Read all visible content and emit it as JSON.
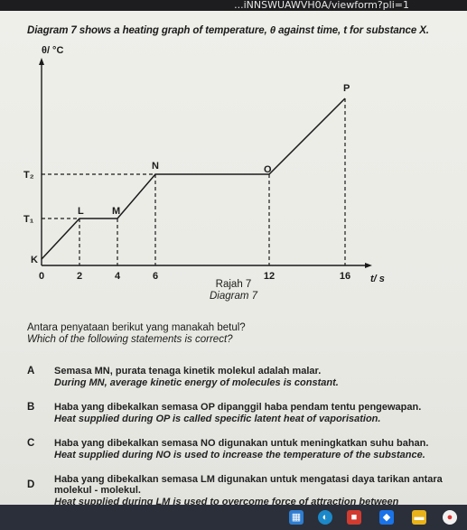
{
  "browser": {
    "url_fragment": "...iNNSWUAWVH0A/viewform?pli=1"
  },
  "intro": "Diagram 7 shows a heating graph of temperature, θ against time, t for substance X.",
  "chart_data": {
    "type": "line",
    "title": "",
    "ylabel": "θ/ °C",
    "xlabel": "t/ s",
    "x_ticks": [
      "0",
      "2",
      "4",
      "6",
      "12",
      "16"
    ],
    "y_ticks": [
      "T₁",
      "T₂"
    ],
    "points": [
      {
        "label": "K",
        "x": 0,
        "y": "T0"
      },
      {
        "label": "L",
        "x": 2,
        "y": "T1"
      },
      {
        "label": "M",
        "x": 4,
        "y": "T1"
      },
      {
        "label": "N",
        "x": 6,
        "y": "T2"
      },
      {
        "label": "O",
        "x": 12,
        "y": "T2"
      },
      {
        "label": "P",
        "x": 16,
        "y": "Tp"
      }
    ],
    "xlim": [
      0,
      16
    ],
    "grid": false
  },
  "captions": {
    "malay": "Rajah 7",
    "english": "Diagram 7"
  },
  "question": {
    "malay": "Antara penyataan berikut yang manakah betul?",
    "english": "Which of the following statements is correct?"
  },
  "options": [
    {
      "letter": "A",
      "malay": "Semasa MN, purata tenaga kinetik molekul adalah malar.",
      "english": "During MN, average kinetic energy of molecules is constant."
    },
    {
      "letter": "B",
      "malay": "Haba yang dibekalkan semasa OP dipanggil haba pendam tentu pengewapan.",
      "english": "Heat supplied during OP is called specific latent heat of vaporisation."
    },
    {
      "letter": "C",
      "malay": "Haba yang dibekalkan semasa NO digunakan untuk meningkatkan suhu bahan.",
      "english": "Heat supplied during NO is used to increase the temperature of the substance."
    },
    {
      "letter": "D",
      "malay": "Haba yang dibekalkan semasa LM digunakan untuk mengatasi daya tarikan antara molekul - molekul.",
      "english": "Heat supplied during LM is used to overcome force of attraction between"
    }
  ],
  "colors": {
    "paper": "#ececE7",
    "ink": "#1b1b1b",
    "taskbar": "#2a2f3a"
  }
}
